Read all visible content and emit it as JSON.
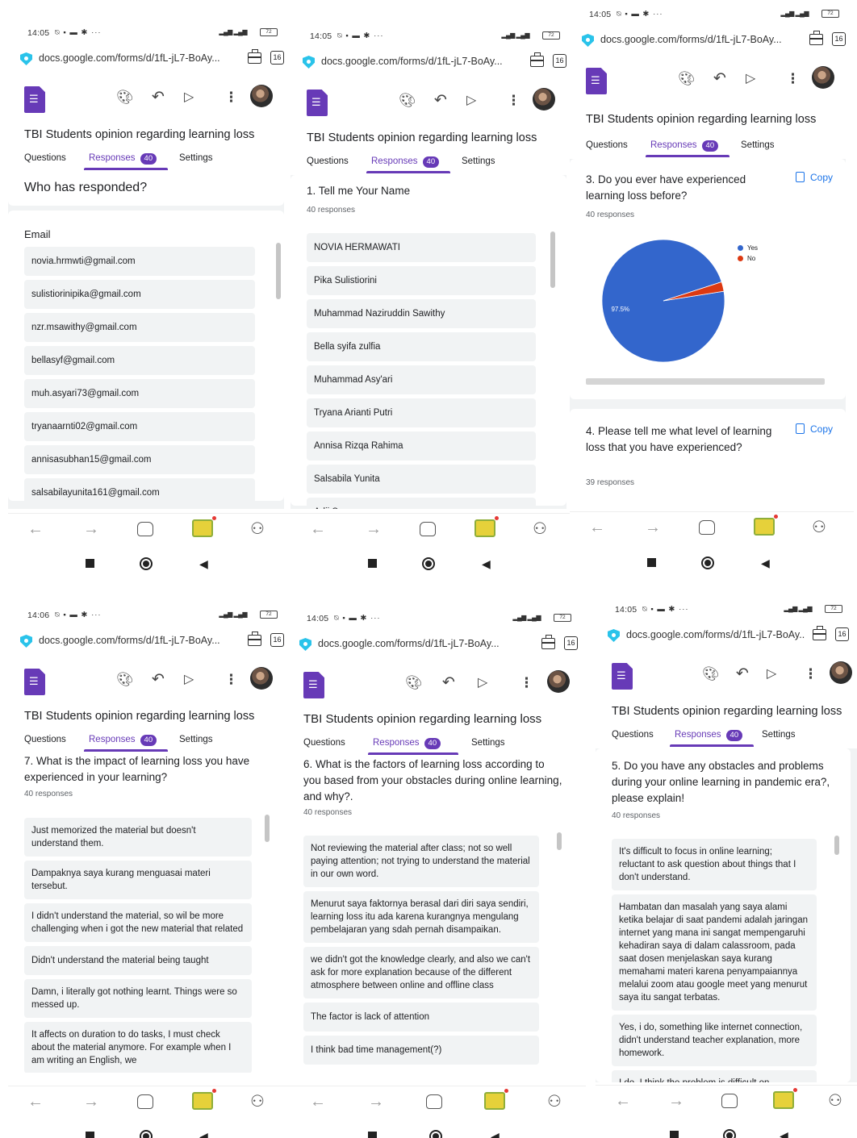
{
  "common": {
    "url": "docs.google.com/forms/d/1fL-jL7-BoAy...",
    "tab_count": "16",
    "battery": "72",
    "form_title": "TBI Students opinion regarding learning loss",
    "tabs": {
      "questions": "Questions",
      "responses": "Responses",
      "responses_count": "40",
      "settings": "Settings"
    },
    "copy_label": "Copy",
    "colors": {
      "accent": "#673ab7",
      "link": "#1a73e8",
      "pie_yes": "#3366cc",
      "pie_no": "#dc3912"
    }
  },
  "phones": [
    {
      "time": "14:05",
      "section_title": "Who has responded?",
      "column_header": "Email",
      "emails": [
        "novia.hrmwti@gmail.com",
        "sulistiorinipika@gmail.com",
        "nzr.msawithy@gmail.com",
        "bellasyf@gmail.com",
        "muh.asyari73@gmail.com",
        "tryanaarnti02@gmail.com",
        "annisasubhan15@gmail.com",
        "salsabilayunita161@gmail.com"
      ]
    },
    {
      "time": "14:05",
      "question": "1. Tell me Your Name",
      "count": "40 responses",
      "responses": [
        "NOVIA HERMAWATI",
        "Pika Sulistiorini",
        "Muhammad Naziruddin Sawithy",
        "Bella syifa zulfia",
        "Muhammad Asy'ari",
        "Tryana Arianti Putri",
        "Annisa Rizqa Rahima",
        "Salsabila Yunita",
        "Adji Suweno"
      ]
    },
    {
      "time": "14:05",
      "q3": {
        "question": "3. Do you ever have experienced learning loss before?",
        "count": "40 responses"
      },
      "q4": {
        "question": "4. Please tell me what level of learning loss that you have experienced?",
        "count": "39 responses"
      }
    },
    {
      "time": "14:06",
      "question": "7. What is the impact of learning loss you have experienced in your learning?",
      "count": "40 responses",
      "responses": [
        "Just memorized the material but doesn't understand them.",
        "Dampaknya saya kurang menguasai materi tersebut.",
        "I didn't understand the material, so wil be more challenging when i got the new material that related",
        "Didn't understand the material being taught",
        "Damn, i literally got nothing learnt. Things were so messed up.",
        "It affects on duration to do tasks, I must check about the material anymore. For example when I am writing an English, we"
      ]
    },
    {
      "time": "14:05",
      "question": "6. What is the factors of learning loss according to you based from your obstacles during online learning, and why?.",
      "count": "40 responses",
      "responses": [
        "Not reviewing the material after class; not so well paying attention; not trying to understand the material in our own word.",
        "Menurut saya faktornya berasal dari diri saya sendiri, learning loss itu ada karena kurangnya mengulang pembelajaran yang sdah pernah disampaikan.",
        "we didn't got the knowledge clearly, and also we can't ask for more explanation because of the different atmosphere between online and offline class",
        "The factor is lack of attention",
        "I think bad time management(?)"
      ]
    },
    {
      "time": "14:05",
      "question": "5. Do you have any obstacles and problems during your online learning in pandemic era?, please explain!",
      "count": "40 responses",
      "responses": [
        "It's difficult to focus in online learning; reluctant to ask question about things that I don't understand.",
        "Hambatan dan masalah yang saya alami ketika belajar di saat pandemi adalah jaringan internet yang mana ini sangat mempengaruhi kehadiran saya di dalam calassroom, pada saat dosen menjelaskan saya kurang memahami materi karena penyampaiannya melalui zoom atau google meet yang menurut saya itu sangat terbatas.",
        "Yes, i do, something like internet connection, didn't understand teacher explanation, more homework.",
        "I do, I think the problem is difficult on"
      ]
    }
  ],
  "chart_data": {
    "type": "pie",
    "title": "",
    "labels": [
      "Yes",
      "No"
    ],
    "values": [
      97.5,
      2.5
    ],
    "data_labels": [
      "97.5%",
      ""
    ],
    "legend": "top-right"
  }
}
